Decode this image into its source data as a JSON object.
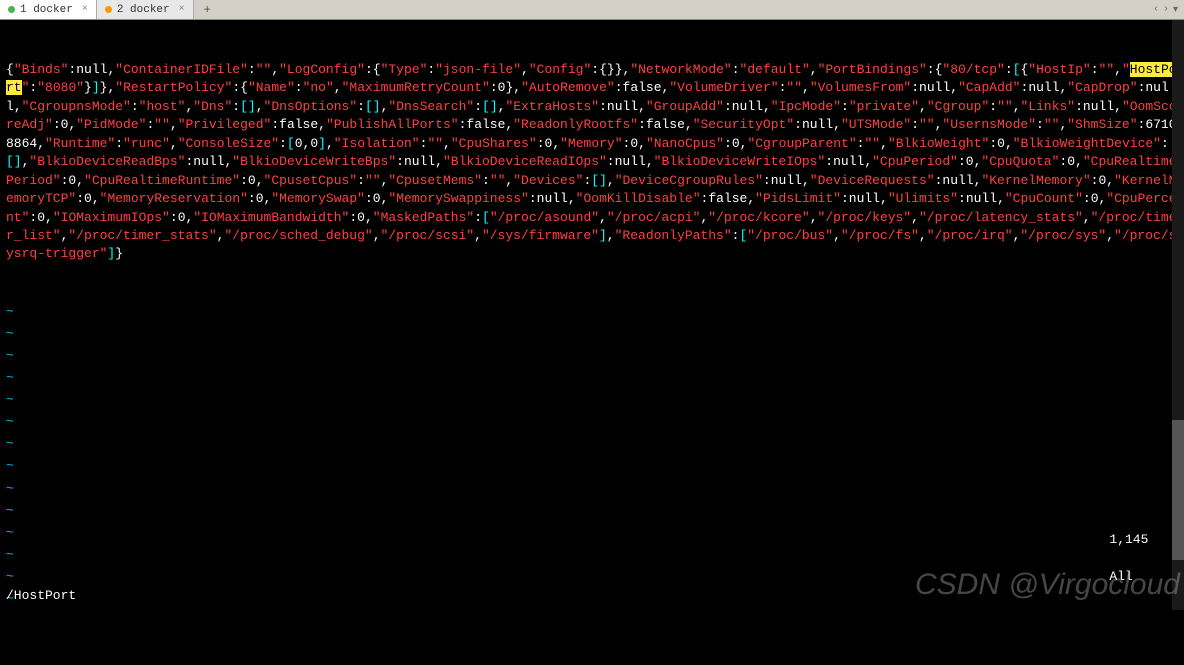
{
  "tabs": [
    {
      "label": "1 docker",
      "dot": "green",
      "active": true
    },
    {
      "label": "2 docker",
      "dot": "orange",
      "active": false
    }
  ],
  "tab_add": "+",
  "nav": {
    "left": "‹",
    "right": "›",
    "down": "▾"
  },
  "search_term": "/HostPort",
  "cursor_pos": "1,145",
  "scroll_pos": "All",
  "watermark": "CSDN @Virgocloud",
  "tilde": "~",
  "highlighted_key": "HostPort",
  "json_tokens": [
    {
      "t": "brce",
      "v": "{"
    },
    {
      "t": "key",
      "v": "\"Binds\""
    },
    {
      "t": "punct",
      "v": ":"
    },
    {
      "t": "kw",
      "v": "null"
    },
    {
      "t": "punct",
      "v": ","
    },
    {
      "t": "key",
      "v": "\"ContainerIDFile\""
    },
    {
      "t": "punct",
      "v": ":"
    },
    {
      "t": "str",
      "v": "\"\""
    },
    {
      "t": "punct",
      "v": ","
    },
    {
      "t": "key",
      "v": "\"LogConfig\""
    },
    {
      "t": "punct",
      "v": ":"
    },
    {
      "t": "brce",
      "v": "{"
    },
    {
      "t": "key",
      "v": "\"Type\""
    },
    {
      "t": "punct",
      "v": ":"
    },
    {
      "t": "str",
      "v": "\"json-file\""
    },
    {
      "t": "punct",
      "v": ","
    },
    {
      "t": "key",
      "v": "\"Config\""
    },
    {
      "t": "punct",
      "v": ":"
    },
    {
      "t": "brce",
      "v": "{}"
    },
    {
      "t": "brce",
      "v": "}"
    },
    {
      "t": "punct",
      "v": ","
    },
    {
      "t": "key",
      "v": "\"NetworkMode\""
    },
    {
      "t": "punct",
      "v": ":"
    },
    {
      "t": "str",
      "v": "\"default\""
    },
    {
      "t": "punct",
      "v": ","
    },
    {
      "t": "key",
      "v": "\"PortBindings\""
    },
    {
      "t": "punct",
      "v": ":"
    },
    {
      "t": "brce",
      "v": "{"
    },
    {
      "t": "key",
      "v": "\"80/tcp\""
    },
    {
      "t": "punct",
      "v": ":"
    },
    {
      "t": "brkt",
      "v": "["
    },
    {
      "t": "brce",
      "v": "{"
    },
    {
      "t": "key",
      "v": "\"HostIp\""
    },
    {
      "t": "punct",
      "v": ":"
    },
    {
      "t": "str",
      "v": "\"\""
    },
    {
      "t": "punct",
      "v": ","
    },
    {
      "t": "key",
      "v": "\""
    },
    {
      "t": "cursor",
      "v": "H"
    },
    {
      "t": "hl",
      "v": "ostPort"
    },
    {
      "t": "key",
      "v": "\""
    },
    {
      "t": "punct",
      "v": ":"
    },
    {
      "t": "str",
      "v": "\"8080\""
    },
    {
      "t": "brce",
      "v": "}"
    },
    {
      "t": "brkt",
      "v": "]"
    },
    {
      "t": "brce",
      "v": "}"
    },
    {
      "t": "punct",
      "v": ","
    },
    {
      "t": "key",
      "v": "\"RestartPolicy\""
    },
    {
      "t": "punct",
      "v": ":"
    },
    {
      "t": "brce",
      "v": "{"
    },
    {
      "t": "key",
      "v": "\"Name\""
    },
    {
      "t": "punct",
      "v": ":"
    },
    {
      "t": "str",
      "v": "\"no\""
    },
    {
      "t": "punct",
      "v": ","
    },
    {
      "t": "key",
      "v": "\"MaximumRetryCount\""
    },
    {
      "t": "punct",
      "v": ":"
    },
    {
      "t": "num",
      "v": "0"
    },
    {
      "t": "brce",
      "v": "}"
    },
    {
      "t": "punct",
      "v": ","
    },
    {
      "t": "key",
      "v": "\"AutoRemove\""
    },
    {
      "t": "punct",
      "v": ":"
    },
    {
      "t": "kw",
      "v": "false"
    },
    {
      "t": "punct",
      "v": ","
    },
    {
      "t": "key",
      "v": "\"VolumeDriver\""
    },
    {
      "t": "punct",
      "v": ":"
    },
    {
      "t": "str",
      "v": "\"\""
    },
    {
      "t": "punct",
      "v": ","
    },
    {
      "t": "key",
      "v": "\"VolumesFrom\""
    },
    {
      "t": "punct",
      "v": ":"
    },
    {
      "t": "kw",
      "v": "null"
    },
    {
      "t": "punct",
      "v": ","
    },
    {
      "t": "key",
      "v": "\"CapAdd\""
    },
    {
      "t": "punct",
      "v": ":"
    },
    {
      "t": "kw",
      "v": "null"
    },
    {
      "t": "punct",
      "v": ","
    },
    {
      "t": "key",
      "v": "\"CapDrop\""
    },
    {
      "t": "punct",
      "v": ":"
    },
    {
      "t": "kw",
      "v": "null"
    },
    {
      "t": "punct",
      "v": ","
    },
    {
      "t": "key",
      "v": "\"CgroupnsMode\""
    },
    {
      "t": "punct",
      "v": ":"
    },
    {
      "t": "str",
      "v": "\"host\""
    },
    {
      "t": "punct",
      "v": ","
    },
    {
      "t": "key",
      "v": "\"Dns\""
    },
    {
      "t": "punct",
      "v": ":"
    },
    {
      "t": "brkt",
      "v": "[]"
    },
    {
      "t": "punct",
      "v": ","
    },
    {
      "t": "key",
      "v": "\"DnsOptions\""
    },
    {
      "t": "punct",
      "v": ":"
    },
    {
      "t": "brkt",
      "v": "[]"
    },
    {
      "t": "punct",
      "v": ","
    },
    {
      "t": "key",
      "v": "\"DnsSearch\""
    },
    {
      "t": "punct",
      "v": ":"
    },
    {
      "t": "brkt",
      "v": "[]"
    },
    {
      "t": "punct",
      "v": ","
    },
    {
      "t": "key",
      "v": "\"ExtraHosts\""
    },
    {
      "t": "punct",
      "v": ":"
    },
    {
      "t": "kw",
      "v": "null"
    },
    {
      "t": "punct",
      "v": ","
    },
    {
      "t": "key",
      "v": "\"GroupAdd\""
    },
    {
      "t": "punct",
      "v": ":"
    },
    {
      "t": "kw",
      "v": "null"
    },
    {
      "t": "punct",
      "v": ","
    },
    {
      "t": "key",
      "v": "\"IpcMode\""
    },
    {
      "t": "punct",
      "v": ":"
    },
    {
      "t": "str",
      "v": "\"private\""
    },
    {
      "t": "punct",
      "v": ","
    },
    {
      "t": "key",
      "v": "\"Cgroup\""
    },
    {
      "t": "punct",
      "v": ":"
    },
    {
      "t": "str",
      "v": "\"\""
    },
    {
      "t": "punct",
      "v": ","
    },
    {
      "t": "key",
      "v": "\"Links\""
    },
    {
      "t": "punct",
      "v": ":"
    },
    {
      "t": "kw",
      "v": "null"
    },
    {
      "t": "punct",
      "v": ","
    },
    {
      "t": "key",
      "v": "\"OomScoreAdj\""
    },
    {
      "t": "punct",
      "v": ":"
    },
    {
      "t": "num",
      "v": "0"
    },
    {
      "t": "punct",
      "v": ","
    },
    {
      "t": "key",
      "v": "\"PidMode\""
    },
    {
      "t": "punct",
      "v": ":"
    },
    {
      "t": "str",
      "v": "\"\""
    },
    {
      "t": "punct",
      "v": ","
    },
    {
      "t": "key",
      "v": "\"Privileged\""
    },
    {
      "t": "punct",
      "v": ":"
    },
    {
      "t": "kw",
      "v": "false"
    },
    {
      "t": "punct",
      "v": ","
    },
    {
      "t": "key",
      "v": "\"PublishAllPorts\""
    },
    {
      "t": "punct",
      "v": ":"
    },
    {
      "t": "kw",
      "v": "false"
    },
    {
      "t": "punct",
      "v": ","
    },
    {
      "t": "key",
      "v": "\"ReadonlyRootfs\""
    },
    {
      "t": "punct",
      "v": ":"
    },
    {
      "t": "kw",
      "v": "false"
    },
    {
      "t": "punct",
      "v": ","
    },
    {
      "t": "key",
      "v": "\"SecurityOpt\""
    },
    {
      "t": "punct",
      "v": ":"
    },
    {
      "t": "kw",
      "v": "null"
    },
    {
      "t": "punct",
      "v": ","
    },
    {
      "t": "key",
      "v": "\"UTSMode\""
    },
    {
      "t": "punct",
      "v": ":"
    },
    {
      "t": "str",
      "v": "\"\""
    },
    {
      "t": "punct",
      "v": ","
    },
    {
      "t": "key",
      "v": "\"UsernsMode\""
    },
    {
      "t": "punct",
      "v": ":"
    },
    {
      "t": "str",
      "v": "\"\""
    },
    {
      "t": "punct",
      "v": ","
    },
    {
      "t": "key",
      "v": "\"ShmSize\""
    },
    {
      "t": "punct",
      "v": ":"
    },
    {
      "t": "num",
      "v": "67108864"
    },
    {
      "t": "punct",
      "v": ","
    },
    {
      "t": "key",
      "v": "\"Runtime\""
    },
    {
      "t": "punct",
      "v": ":"
    },
    {
      "t": "str",
      "v": "\"runc\""
    },
    {
      "t": "punct",
      "v": ","
    },
    {
      "t": "key",
      "v": "\"ConsoleSize\""
    },
    {
      "t": "punct",
      "v": ":"
    },
    {
      "t": "brkt",
      "v": "["
    },
    {
      "t": "num",
      "v": "0"
    },
    {
      "t": "punct",
      "v": ","
    },
    {
      "t": "num",
      "v": "0"
    },
    {
      "t": "brkt",
      "v": "]"
    },
    {
      "t": "punct",
      "v": ","
    },
    {
      "t": "key",
      "v": "\"Isolation\""
    },
    {
      "t": "punct",
      "v": ":"
    },
    {
      "t": "str",
      "v": "\"\""
    },
    {
      "t": "punct",
      "v": ","
    },
    {
      "t": "key",
      "v": "\"CpuShares\""
    },
    {
      "t": "punct",
      "v": ":"
    },
    {
      "t": "num",
      "v": "0"
    },
    {
      "t": "punct",
      "v": ","
    },
    {
      "t": "key",
      "v": "\"Memory\""
    },
    {
      "t": "punct",
      "v": ":"
    },
    {
      "t": "num",
      "v": "0"
    },
    {
      "t": "punct",
      "v": ","
    },
    {
      "t": "key",
      "v": "\"NanoCpus\""
    },
    {
      "t": "punct",
      "v": ":"
    },
    {
      "t": "num",
      "v": "0"
    },
    {
      "t": "punct",
      "v": ","
    },
    {
      "t": "key",
      "v": "\"CgroupParent\""
    },
    {
      "t": "punct",
      "v": ":"
    },
    {
      "t": "str",
      "v": "\"\""
    },
    {
      "t": "punct",
      "v": ","
    },
    {
      "t": "key",
      "v": "\"BlkioWeight\""
    },
    {
      "t": "punct",
      "v": ":"
    },
    {
      "t": "num",
      "v": "0"
    },
    {
      "t": "punct",
      "v": ","
    },
    {
      "t": "key",
      "v": "\"BlkioWeightDevice\""
    },
    {
      "t": "punct",
      "v": ":"
    },
    {
      "t": "brkt",
      "v": "[]"
    },
    {
      "t": "punct",
      "v": ","
    },
    {
      "t": "key",
      "v": "\"BlkioDeviceReadBps\""
    },
    {
      "t": "punct",
      "v": ":"
    },
    {
      "t": "kw",
      "v": "null"
    },
    {
      "t": "punct",
      "v": ","
    },
    {
      "t": "key",
      "v": "\"BlkioDeviceWriteBps\""
    },
    {
      "t": "punct",
      "v": ":"
    },
    {
      "t": "kw",
      "v": "null"
    },
    {
      "t": "punct",
      "v": ","
    },
    {
      "t": "key",
      "v": "\"BlkioDeviceReadIOps\""
    },
    {
      "t": "punct",
      "v": ":"
    },
    {
      "t": "kw",
      "v": "null"
    },
    {
      "t": "punct",
      "v": ","
    },
    {
      "t": "key",
      "v": "\"BlkioDeviceWriteIOps\""
    },
    {
      "t": "punct",
      "v": ":"
    },
    {
      "t": "kw",
      "v": "null"
    },
    {
      "t": "punct",
      "v": ","
    },
    {
      "t": "key",
      "v": "\"CpuPeriod\""
    },
    {
      "t": "punct",
      "v": ":"
    },
    {
      "t": "num",
      "v": "0"
    },
    {
      "t": "punct",
      "v": ","
    },
    {
      "t": "key",
      "v": "\"CpuQuota\""
    },
    {
      "t": "punct",
      "v": ":"
    },
    {
      "t": "num",
      "v": "0"
    },
    {
      "t": "punct",
      "v": ","
    },
    {
      "t": "key",
      "v": "\"CpuRealtimePeriod\""
    },
    {
      "t": "punct",
      "v": ":"
    },
    {
      "t": "num",
      "v": "0"
    },
    {
      "t": "punct",
      "v": ","
    },
    {
      "t": "key",
      "v": "\"CpuRealtimeRuntime\""
    },
    {
      "t": "punct",
      "v": ":"
    },
    {
      "t": "num",
      "v": "0"
    },
    {
      "t": "punct",
      "v": ","
    },
    {
      "t": "key",
      "v": "\"CpusetCpus\""
    },
    {
      "t": "punct",
      "v": ":"
    },
    {
      "t": "str",
      "v": "\"\""
    },
    {
      "t": "punct",
      "v": ","
    },
    {
      "t": "key",
      "v": "\"CpusetMems\""
    },
    {
      "t": "punct",
      "v": ":"
    },
    {
      "t": "str",
      "v": "\"\""
    },
    {
      "t": "punct",
      "v": ","
    },
    {
      "t": "key",
      "v": "\"Devices\""
    },
    {
      "t": "punct",
      "v": ":"
    },
    {
      "t": "brkt",
      "v": "[]"
    },
    {
      "t": "punct",
      "v": ","
    },
    {
      "t": "key",
      "v": "\"DeviceCgroupRules\""
    },
    {
      "t": "punct",
      "v": ":"
    },
    {
      "t": "kw",
      "v": "null"
    },
    {
      "t": "punct",
      "v": ","
    },
    {
      "t": "key",
      "v": "\"DeviceRequests\""
    },
    {
      "t": "punct",
      "v": ":"
    },
    {
      "t": "kw",
      "v": "null"
    },
    {
      "t": "punct",
      "v": ","
    },
    {
      "t": "key",
      "v": "\"KernelMemory\""
    },
    {
      "t": "punct",
      "v": ":"
    },
    {
      "t": "num",
      "v": "0"
    },
    {
      "t": "punct",
      "v": ","
    },
    {
      "t": "key",
      "v": "\"KernelMemoryTCP\""
    },
    {
      "t": "punct",
      "v": ":"
    },
    {
      "t": "num",
      "v": "0"
    },
    {
      "t": "punct",
      "v": ","
    },
    {
      "t": "key",
      "v": "\"MemoryReservation\""
    },
    {
      "t": "punct",
      "v": ":"
    },
    {
      "t": "num",
      "v": "0"
    },
    {
      "t": "punct",
      "v": ","
    },
    {
      "t": "key",
      "v": "\"MemorySwap\""
    },
    {
      "t": "punct",
      "v": ":"
    },
    {
      "t": "num",
      "v": "0"
    },
    {
      "t": "punct",
      "v": ","
    },
    {
      "t": "key",
      "v": "\"MemorySwappiness\""
    },
    {
      "t": "punct",
      "v": ":"
    },
    {
      "t": "kw",
      "v": "null"
    },
    {
      "t": "punct",
      "v": ","
    },
    {
      "t": "key",
      "v": "\"OomKillDisable\""
    },
    {
      "t": "punct",
      "v": ":"
    },
    {
      "t": "kw",
      "v": "false"
    },
    {
      "t": "punct",
      "v": ","
    },
    {
      "t": "key",
      "v": "\"PidsLimit\""
    },
    {
      "t": "punct",
      "v": ":"
    },
    {
      "t": "kw",
      "v": "null"
    },
    {
      "t": "punct",
      "v": ","
    },
    {
      "t": "key",
      "v": "\"Ulimits\""
    },
    {
      "t": "punct",
      "v": ":"
    },
    {
      "t": "kw",
      "v": "null"
    },
    {
      "t": "punct",
      "v": ","
    },
    {
      "t": "key",
      "v": "\"CpuCount\""
    },
    {
      "t": "punct",
      "v": ":"
    },
    {
      "t": "num",
      "v": "0"
    },
    {
      "t": "punct",
      "v": ","
    },
    {
      "t": "key",
      "v": "\"CpuPercent\""
    },
    {
      "t": "punct",
      "v": ":"
    },
    {
      "t": "num",
      "v": "0"
    },
    {
      "t": "punct",
      "v": ","
    },
    {
      "t": "key",
      "v": "\"IOMaximumIOps\""
    },
    {
      "t": "punct",
      "v": ":"
    },
    {
      "t": "num",
      "v": "0"
    },
    {
      "t": "punct",
      "v": ","
    },
    {
      "t": "key",
      "v": "\"IOMaximumBandwidth\""
    },
    {
      "t": "punct",
      "v": ":"
    },
    {
      "t": "num",
      "v": "0"
    },
    {
      "t": "punct",
      "v": ","
    },
    {
      "t": "key",
      "v": "\"MaskedPaths\""
    },
    {
      "t": "punct",
      "v": ":"
    },
    {
      "t": "brkt",
      "v": "["
    },
    {
      "t": "str",
      "v": "\"/proc/asound\""
    },
    {
      "t": "punct",
      "v": ","
    },
    {
      "t": "str",
      "v": "\"/proc/acpi\""
    },
    {
      "t": "punct",
      "v": ","
    },
    {
      "t": "str",
      "v": "\"/proc/kcore\""
    },
    {
      "t": "punct",
      "v": ","
    },
    {
      "t": "str",
      "v": "\"/proc/keys\""
    },
    {
      "t": "punct",
      "v": ","
    },
    {
      "t": "str",
      "v": "\"/proc/latency_stats\""
    },
    {
      "t": "punct",
      "v": ","
    },
    {
      "t": "str",
      "v": "\"/proc/timer_list\""
    },
    {
      "t": "punct",
      "v": ","
    },
    {
      "t": "str",
      "v": "\"/proc/timer_stats\""
    },
    {
      "t": "punct",
      "v": ","
    },
    {
      "t": "str",
      "v": "\"/proc/sched_debug\""
    },
    {
      "t": "punct",
      "v": ","
    },
    {
      "t": "str",
      "v": "\"/proc/scsi\""
    },
    {
      "t": "punct",
      "v": ","
    },
    {
      "t": "str",
      "v": "\"/sys/firmware\""
    },
    {
      "t": "brkt",
      "v": "]"
    },
    {
      "t": "punct",
      "v": ","
    },
    {
      "t": "key",
      "v": "\"ReadonlyPaths\""
    },
    {
      "t": "punct",
      "v": ":"
    },
    {
      "t": "brkt",
      "v": "["
    },
    {
      "t": "str",
      "v": "\"/proc/bus\""
    },
    {
      "t": "punct",
      "v": ","
    },
    {
      "t": "str",
      "v": "\"/proc/fs\""
    },
    {
      "t": "punct",
      "v": ","
    },
    {
      "t": "str",
      "v": "\"/proc/irq\""
    },
    {
      "t": "punct",
      "v": ","
    },
    {
      "t": "str",
      "v": "\"/proc/sys\""
    },
    {
      "t": "punct",
      "v": ","
    },
    {
      "t": "str",
      "v": "\"/proc/sysrq-trigger\""
    },
    {
      "t": "brkt",
      "v": "]"
    },
    {
      "t": "brce",
      "v": "}"
    }
  ]
}
